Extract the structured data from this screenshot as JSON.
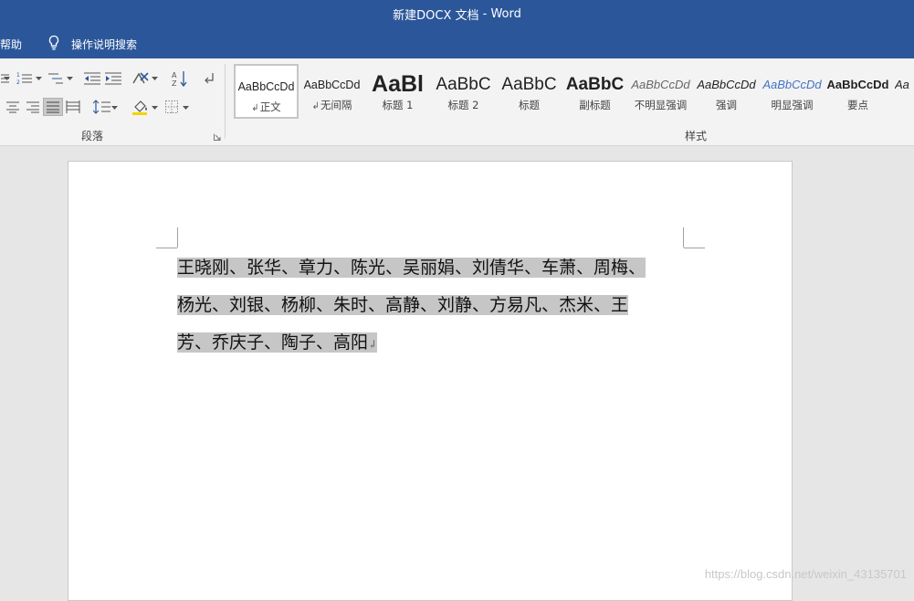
{
  "window": {
    "doc_name": "新建DOCX 文档",
    "separator": " - ",
    "app_name": "Word"
  },
  "menu": {
    "help": "帮助",
    "tell_me": "操作说明搜索"
  },
  "ribbon": {
    "paragraph_group": "段落",
    "styles_group": "样式",
    "styles": [
      {
        "sample": "AaBbCcDd",
        "name": "正文",
        "mark": "↲"
      },
      {
        "sample": "AaBbCcDd",
        "name": "无间隔",
        "mark": "↲"
      },
      {
        "sample": "AaBl",
        "name": "标题 1"
      },
      {
        "sample": "AaBbC",
        "name": "标题 2"
      },
      {
        "sample": "AaBbC",
        "name": "标题"
      },
      {
        "sample": "AaBbC",
        "name": "副标题"
      },
      {
        "sample": "AaBbCcDd",
        "name": "不明显强调"
      },
      {
        "sample": "AaBbCcDd",
        "name": "强调"
      },
      {
        "sample": "AaBbCcDd",
        "name": "明显强调"
      },
      {
        "sample": "AaBbCcDd",
        "name": "要点"
      },
      {
        "sample": "Aa",
        "name": ""
      }
    ]
  },
  "document": {
    "lines": [
      "王晓刚、张华、章力、陈光、吴丽娟、刘倩华、车萧、周梅、",
      "杨光、刘银、杨柳、朱时、高静、刘静、方易凡、杰米、王",
      "芳、乔庆子、陶子、高阳"
    ],
    "paragraph_mark": "↲"
  },
  "watermark": "https://blog.csdn.net/weixin_43135701",
  "colors": {
    "title_bar": "#2b579a",
    "ribbon": "#f3f3f3",
    "canvas": "#e6e6e6",
    "selection": "#c6c6c6"
  }
}
